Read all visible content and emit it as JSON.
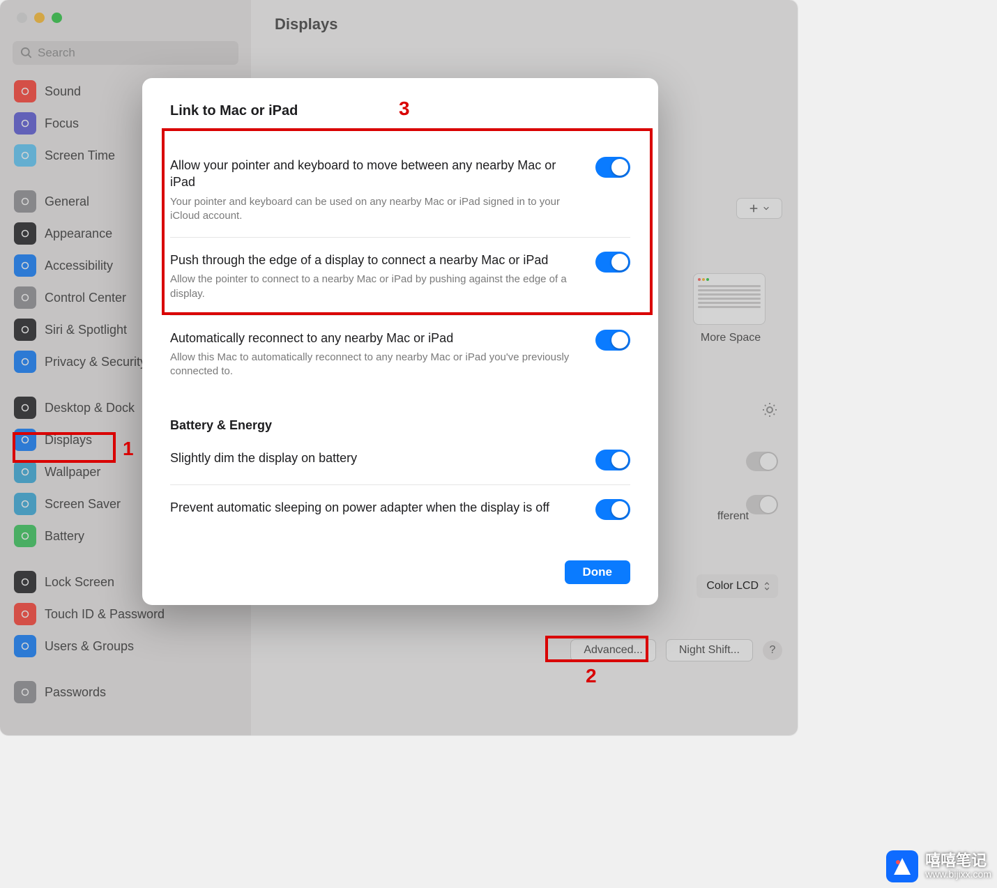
{
  "window": {
    "title": "Displays",
    "search_placeholder": "Search"
  },
  "sidebar": [
    {
      "label": "Sound",
      "name": "sidebar-item-sound",
      "bg": "#ff3b30"
    },
    {
      "label": "Focus",
      "name": "sidebar-item-focus",
      "bg": "#5856d6"
    },
    {
      "label": "Screen Time",
      "name": "sidebar-item-screen-time",
      "bg": "#5ac8fa"
    },
    {
      "label": "_gap"
    },
    {
      "label": "General",
      "name": "sidebar-item-general",
      "bg": "#8e8e93"
    },
    {
      "label": "Appearance",
      "name": "sidebar-item-appearance",
      "bg": "#1d1d1f"
    },
    {
      "label": "Accessibility",
      "name": "sidebar-item-accessibility",
      "bg": "#0a7bff"
    },
    {
      "label": "Control Center",
      "name": "sidebar-item-control-center",
      "bg": "#8e8e93"
    },
    {
      "label": "Siri & Spotlight",
      "name": "sidebar-item-siri-spotlight",
      "bg": "#1d1d1f"
    },
    {
      "label": "Privacy & Security",
      "name": "sidebar-item-privacy",
      "bg": "#0a7bff"
    },
    {
      "label": "_gap"
    },
    {
      "label": "Desktop & Dock",
      "name": "sidebar-item-desktop-dock",
      "bg": "#1d1d1f"
    },
    {
      "label": "Displays",
      "name": "sidebar-item-displays",
      "bg": "#0a7bff"
    },
    {
      "label": "Wallpaper",
      "name": "sidebar-item-wallpaper",
      "bg": "#34aadc"
    },
    {
      "label": "Screen Saver",
      "name": "sidebar-item-screen-saver",
      "bg": "#34aadc"
    },
    {
      "label": "Battery",
      "name": "sidebar-item-battery",
      "bg": "#34c759"
    },
    {
      "label": "_gap"
    },
    {
      "label": "Lock Screen",
      "name": "sidebar-item-lock-screen",
      "bg": "#1d1d1f"
    },
    {
      "label": "Touch ID & Password",
      "name": "sidebar-item-touchid",
      "bg": "#ff3b30"
    },
    {
      "label": "Users & Groups",
      "name": "sidebar-item-users-groups",
      "bg": "#0a7bff"
    },
    {
      "label": "_gap"
    },
    {
      "label": "Passwords",
      "name": "sidebar-item-passwords",
      "bg": "#8e8e93"
    }
  ],
  "content": {
    "more_space": "More Space",
    "color_profile": "Color LCD",
    "advanced": "Advanced...",
    "night_shift": "Night Shift...",
    "fferent": "fferent"
  },
  "modal": {
    "section1": "Link to Mac or iPad",
    "rows": [
      {
        "title": "Allow your pointer and keyboard to move between any nearby Mac or iPad",
        "desc": "Your pointer and keyboard can be used on any nearby Mac or iPad signed in to your iCloud account.",
        "on": true,
        "name": "toggle-universal-control"
      },
      {
        "title": "Push through the edge of a display to connect a nearby Mac or iPad",
        "desc": "Allow the pointer to connect to a nearby Mac or iPad by pushing against the edge of a display.",
        "on": true,
        "name": "toggle-push-edge"
      },
      {
        "title": "Automatically reconnect to any nearby Mac or iPad",
        "desc": "Allow this Mac to automatically reconnect to any nearby Mac or iPad you've previously connected to.",
        "on": true,
        "name": "toggle-auto-reconnect"
      }
    ],
    "section2": "Battery & Energy",
    "rows2": [
      {
        "title": "Slightly dim the display on battery",
        "on": true,
        "name": "toggle-dim-battery"
      },
      {
        "title": "Prevent automatic sleeping on power adapter when the display is off",
        "on": true,
        "name": "toggle-prevent-sleep"
      }
    ],
    "done": "Done"
  },
  "annotations": {
    "l1": "1",
    "l2": "2",
    "l3": "3"
  },
  "watermark": {
    "zh": "嘻嘻笔记",
    "url": "www.bijixx.com"
  }
}
